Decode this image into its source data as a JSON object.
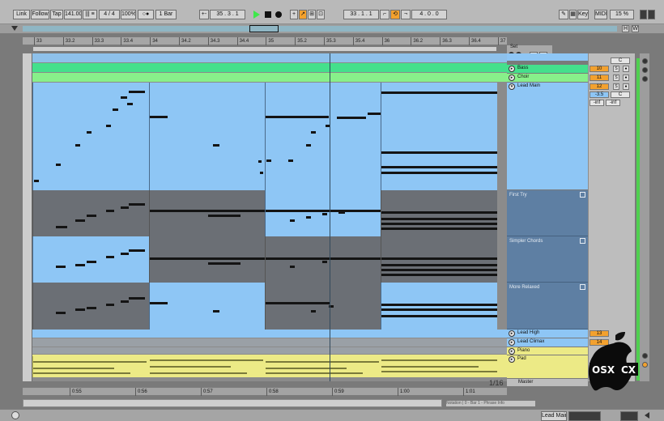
{
  "control_bar": {
    "link": "Link",
    "follow": "Follow",
    "tap": "Tap",
    "tempo": "141.00",
    "time_signature": "4 / 4",
    "zoom": "100%",
    "metronome": "○●",
    "quantize": "1 Bar",
    "position": "35 .   3 .   1",
    "loop_start": "33 .   1 .   1",
    "loop_length": "4 .   0 .   0",
    "key": "Key",
    "midi": "MIDI",
    "cpu": "15 %"
  },
  "overview": {
    "buttons": [
      "H",
      "W"
    ]
  },
  "ruler": {
    "bars": [
      "33",
      "33.2",
      "33.3",
      "33.4",
      "34",
      "34.2",
      "34.3",
      "34.4",
      "35",
      "35.2",
      "35.3",
      "35.4",
      "36",
      "36.2",
      "36.3",
      "36.4",
      "37"
    ]
  },
  "set_label": "Set",
  "tracks": [
    {
      "name": "Bass",
      "volume": "10",
      "pan": "C"
    },
    {
      "name": "Choir",
      "volume": "11",
      "pan": "C"
    },
    {
      "name": "Lead Main",
      "volume": "12",
      "pan": "S",
      "volume_db": "-3.5",
      "pan_value": "C",
      "sends": [
        "-inf",
        "-inf"
      ]
    }
  ],
  "lanes": [
    {
      "label": "First Try"
    },
    {
      "label": "Simpler Chords"
    },
    {
      "label": "More Relaxed"
    }
  ],
  "lower_tracks": [
    {
      "name": "Lead High",
      "volume": "13"
    },
    {
      "name": "Lead Climax",
      "volume": "14"
    },
    {
      "name": "Piano"
    },
    {
      "name": "Pad"
    }
  ],
  "master": "Master",
  "zoom_ratio": "1/16",
  "time_ruler": [
    "0:55",
    "0:56",
    "0:57",
    "0:58",
    "0:59",
    "1:00",
    "1:01"
  ],
  "status": {
    "track_label": "Lead Main",
    "clip_info": "Notation | 0 - Bar 1 - Phrase Info"
  },
  "logo": {
    "text_left": "OSX",
    "text_right": "CX"
  },
  "colors": {
    "clip_blue": "#8ec6f5",
    "clip_grey": "#6b6f75",
    "bass_green": "#44e08c",
    "choir_green": "#88f08a",
    "pad_yellow": "#ecea86",
    "accent_orange": "#f3a12e",
    "lane_header_blue": "#5e7fa3"
  }
}
